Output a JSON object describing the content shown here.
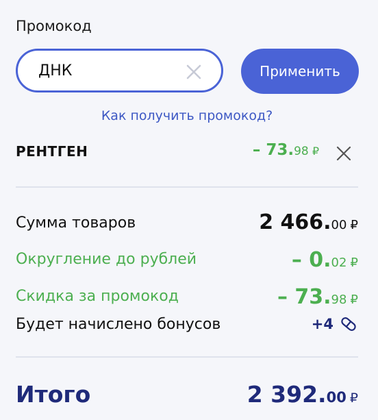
{
  "promo": {
    "title": "Промокод",
    "input_value": "ДНК",
    "apply_label": "Применить",
    "how_to_get": "Как получить промокод?"
  },
  "coupon": {
    "name": "РЕНТГЕН",
    "int": "– 73.",
    "dec": "98",
    "currency": "₽"
  },
  "summary": {
    "goods": {
      "label": "Сумма товаров",
      "int": "2 466.",
      "dec": "00",
      "currency": "₽"
    },
    "rounding": {
      "label": "Округление до рублей",
      "int": "– 0.",
      "dec": "02",
      "currency": "₽"
    },
    "discount": {
      "label": "Скидка за промокод",
      "int": "– 73.",
      "dec": "98",
      "currency": "₽"
    },
    "bonus": {
      "label": "Будет начислено бонусов",
      "value": "+4"
    }
  },
  "total": {
    "label": "Итого",
    "int": "2 392.",
    "dec": "00",
    "currency": "₽"
  },
  "colors": {
    "accent": "#4a63d6",
    "green": "#4caf50",
    "navy": "#1f2a7a"
  }
}
